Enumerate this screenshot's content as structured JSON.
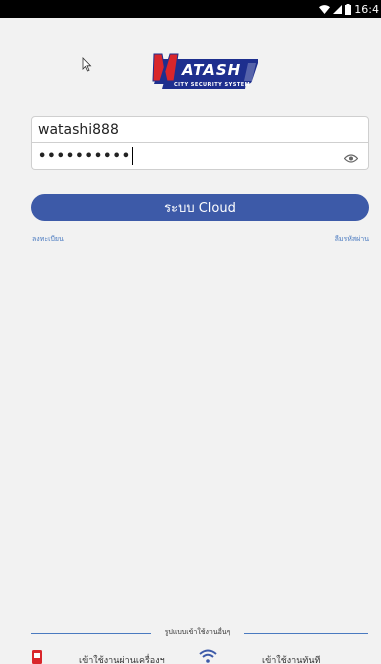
{
  "status_bar": {
    "time": "16:4",
    "icons": [
      "wifi-icon",
      "signal-icon",
      "battery-icon"
    ]
  },
  "logo": {
    "text": "ATASH",
    "subtitle": "CITY SECURITY SYSTEM",
    "colors": {
      "primary": "#1e2f8e",
      "accent": "#d9262b"
    }
  },
  "login": {
    "username_value": "watashi888",
    "password_value": "••••••••••",
    "cloud_button_label": "ระบบ Cloud",
    "register_link": "ลงทะเบียน",
    "forgot_link": "ลืมรหัสผ่าน"
  },
  "bottom": {
    "divider_label": "รูปแบบเข้าใช้งานอื่นๆ",
    "device_login_label": "เข้าใช้งานผ่านเครื่องฯ",
    "instant_login_label": "เข้าใช้งานทันที"
  },
  "colors": {
    "accent": "#3d5aa8",
    "link": "#4a7ac0",
    "background": "#f2f2f2"
  }
}
